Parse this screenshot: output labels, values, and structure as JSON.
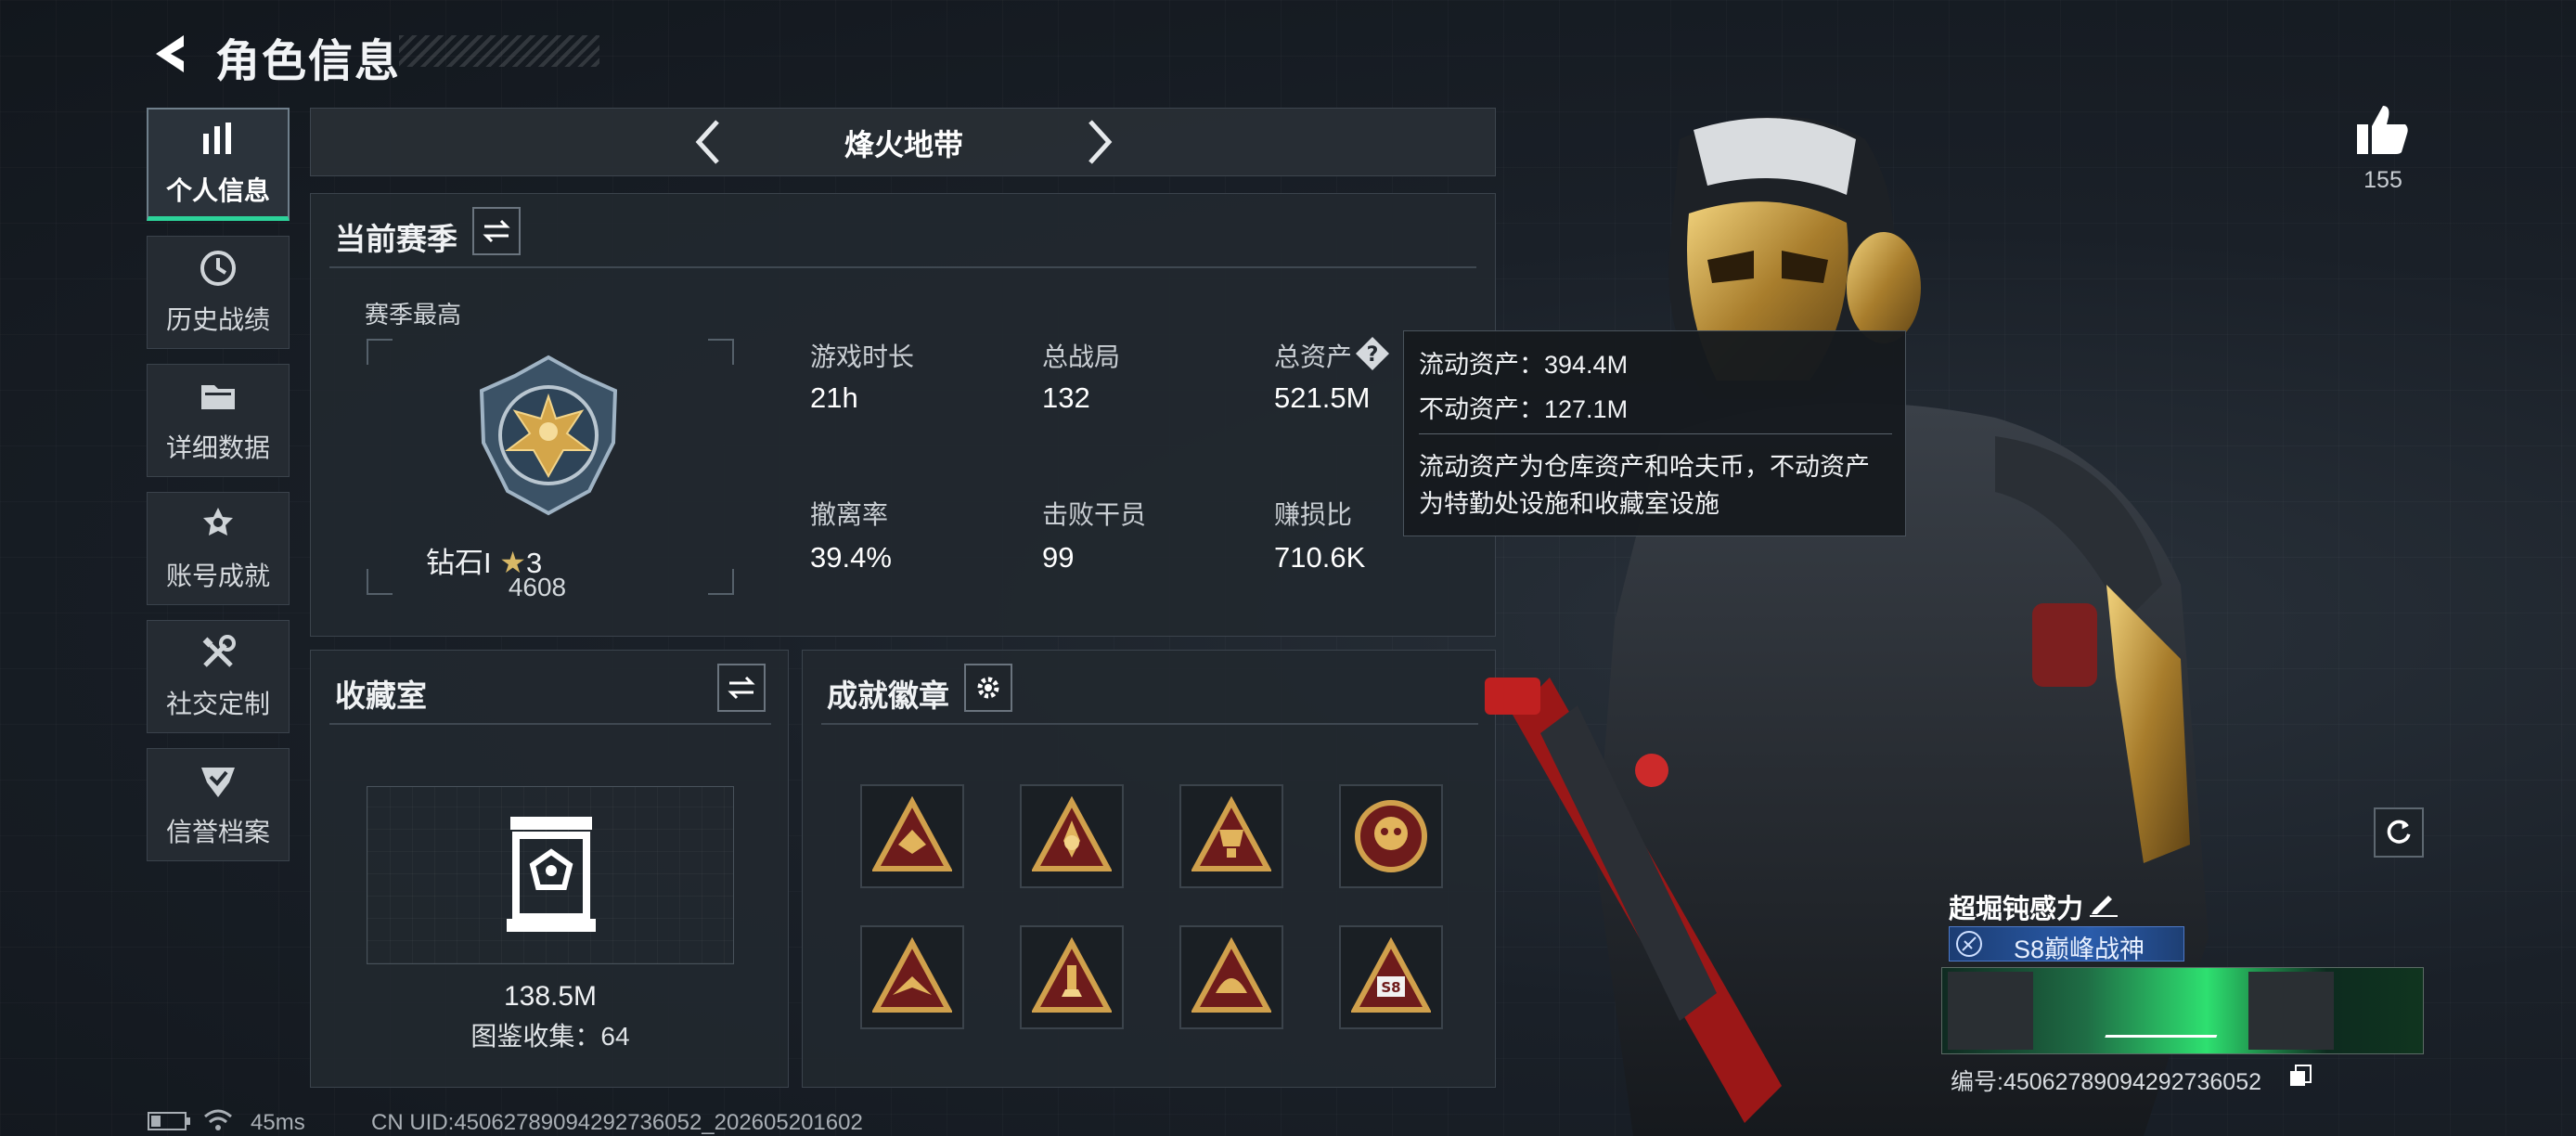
{
  "header": {
    "title": "角色信息"
  },
  "sidebar": {
    "items": [
      {
        "label": "个人信息",
        "icon": "bar-chart-icon",
        "active": true
      },
      {
        "label": "历史战绩",
        "icon": "history-clock-icon",
        "active": false
      },
      {
        "label": "详细数据",
        "icon": "folder-icon",
        "active": false
      },
      {
        "label": "账号成就",
        "icon": "medal-icon",
        "active": false
      },
      {
        "label": "社交定制",
        "icon": "tools-icon",
        "active": false
      },
      {
        "label": "信誉档案",
        "icon": "shield-check-icon",
        "active": false
      }
    ]
  },
  "mode": {
    "name": "烽火地带"
  },
  "season": {
    "title": "当前赛季",
    "highest_label": "赛季最高",
    "rank_name": "钻石I",
    "rank_stars": "3",
    "rank_points": "4608",
    "stats": [
      {
        "label": "游戏时长",
        "value": "21h"
      },
      {
        "label": "总战局",
        "value": "132"
      },
      {
        "label": "总资产",
        "value": "521.5M"
      },
      {
        "label": "撤离率",
        "value": "39.4%"
      },
      {
        "label": "击败干员",
        "value": "99"
      },
      {
        "label": "赚损比",
        "value": "710.6K"
      }
    ]
  },
  "tooltip": {
    "liquid": "流动资产：394.4M",
    "fixed": "不动资产：127.1M",
    "desc_line1": "流动资产为仓库资产和哈夫币，不动资产",
    "desc_line2": "为特勤处设施和收藏室设施"
  },
  "collection": {
    "title": "收藏室",
    "value": "138.5M",
    "collected": "图鉴收集：64"
  },
  "badges": {
    "title": "成就徽章",
    "items": [
      "badge-1",
      "badge-2",
      "badge-3",
      "badge-4",
      "badge-5",
      "badge-6",
      "badge-7",
      "badge-8"
    ]
  },
  "profile": {
    "likes": "155",
    "name": "超堀钝感力",
    "title_badge": "S8巅峰战神",
    "id_text": "编号:450627890942927360​52"
  },
  "footer": {
    "ping": "45ms",
    "uid": "CN UID:4506278909429273605​2_202605201602"
  },
  "colors": {
    "accent": "#2cd39a",
    "gold": "#c9a24a",
    "badge_red": "#7c1f1f"
  }
}
